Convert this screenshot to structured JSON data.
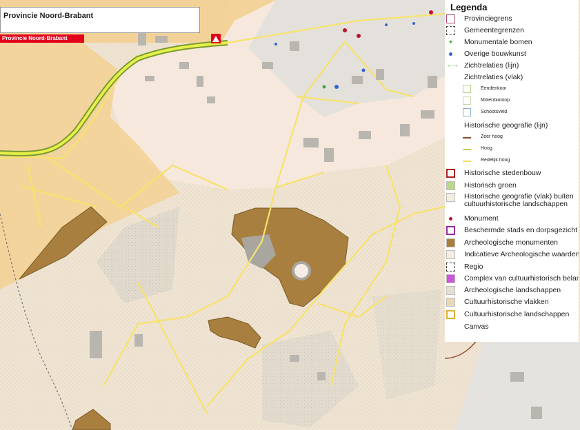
{
  "header": {
    "title": "Provincie Noord-Brabant",
    "brand_label": "Provincie Noord-Brabant"
  },
  "legend": {
    "title": "Legenda",
    "items": [
      {
        "label": "Provinciegrens",
        "symbol": "square-outline",
        "color": "#a3466e"
      },
      {
        "label": "Gemeentegrenzen",
        "symbol": "square-dashed",
        "color": "#555555"
      },
      {
        "label": "Monumentale bomen",
        "symbol": "arrow-dot",
        "color": "#44aa33"
      },
      {
        "label": "Overige bouwkunst",
        "symbol": "dot",
        "color": "#3366cc"
      },
      {
        "label": "Zichtrelaties (lijn)",
        "symbol": "arrow-line",
        "color": "#44aa33"
      },
      {
        "label": "Zichtrelaties (vlak)",
        "symbol": "none",
        "color": ""
      },
      {
        "label": "Eendenkooi",
        "symbol": "square-outline",
        "color": "#b5d48a",
        "sub": true
      },
      {
        "label": "Molenbiotoop",
        "symbol": "square-outline",
        "color": "#c8d8a8",
        "sub": true
      },
      {
        "label": "Schootsveld",
        "symbol": "square-outline",
        "color": "#8fb0c8",
        "sub": true
      },
      {
        "label": "Historische geografie (lijn)",
        "symbol": "none",
        "color": ""
      },
      {
        "label": "Zeer hoog",
        "symbol": "line",
        "color": "#8b4a2a",
        "sub": true
      },
      {
        "label": "Hoog",
        "symbol": "line",
        "color": "#b8d060",
        "sub": true
      },
      {
        "label": "Redelijk hoog",
        "symbol": "line",
        "color": "#f0e060",
        "sub": true
      },
      {
        "label": "Historische stedenbouw",
        "symbol": "square-outline-thick",
        "color": "#b02020"
      },
      {
        "label": "Historisch groen",
        "symbol": "square-fill",
        "color": "#bcd88a"
      },
      {
        "label": "Historische geografie (vlak) buiten cultuurhistorische landschappen",
        "symbol": "square-fill",
        "color": "#f5ede0",
        "two": true
      },
      {
        "label": "Monument",
        "symbol": "dot",
        "color": "#c0102a"
      },
      {
        "label": "Beschermde stads en dorpsgezicht",
        "symbol": "square-outline-thick",
        "color": "#9a2aa0"
      },
      {
        "label": "Archeologische monumenten",
        "symbol": "square-fill",
        "color": "#a87f3e"
      },
      {
        "label": "Indicatieve Archeologische waarden",
        "symbol": "square-fill",
        "color": "#f6ede4"
      },
      {
        "label": "Regio",
        "symbol": "square-dashed",
        "color": "#333333"
      },
      {
        "label": "Complex van cultuurhistorisch belang",
        "symbol": "square-fill",
        "color": "#cc55dd"
      },
      {
        "label": "Archeologische landschappen",
        "symbol": "square-fill",
        "color": "#e6e0d2"
      },
      {
        "label": "Cultuurhistorische vlakken",
        "symbol": "square-fill",
        "color": "#e8d8b8"
      },
      {
        "label": "Cultuurhistorische landschappen",
        "symbol": "square-outline-thick",
        "color": "#d9b030"
      },
      {
        "label": "Canvas",
        "symbol": "none",
        "color": ""
      }
    ]
  }
}
